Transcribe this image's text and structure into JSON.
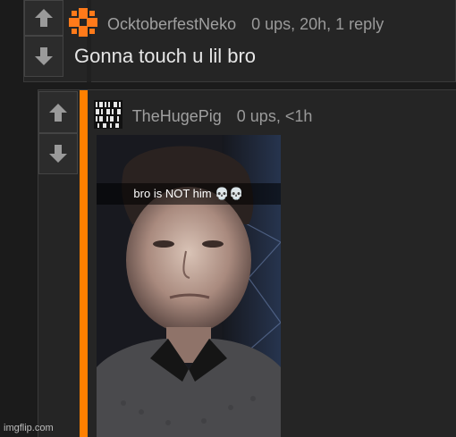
{
  "comments": [
    {
      "username": "OcktoberfestNeko",
      "stats": "0 ups, 20h, 1 reply",
      "text": "Gonna touch u lil bro",
      "avatar_icon": "orange-cross-avatar-icon"
    },
    {
      "username": "TheHugePig",
      "stats": "0 ups, <1h",
      "avatar_icon": "binary-avatar-icon",
      "image": {
        "caption": "bro is NOT him 💀💀"
      }
    }
  ],
  "watermark": "imgflip.com",
  "colors": {
    "accent": "#ff8000",
    "background": "#1b1b1b",
    "panel": "#252525"
  }
}
